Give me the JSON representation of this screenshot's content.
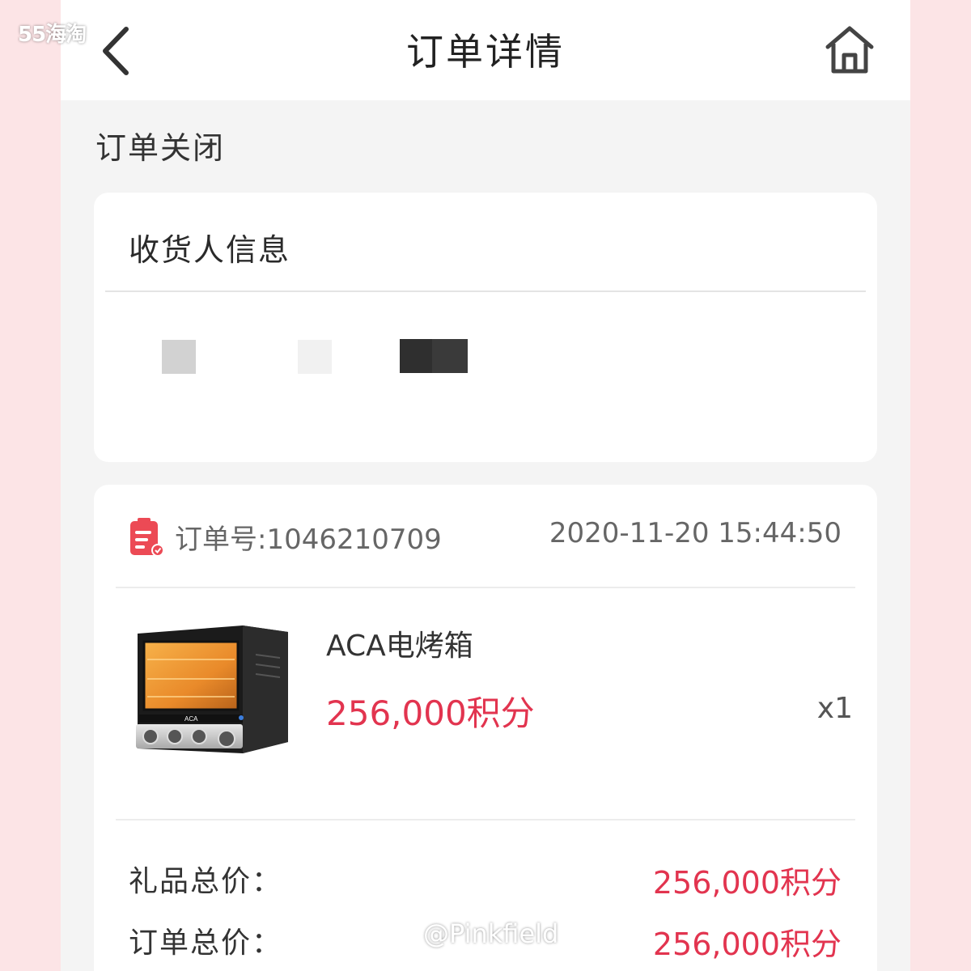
{
  "watermark": {
    "top_left": "55海淘",
    "bottom": "@Pinkfield"
  },
  "navbar": {
    "title": "订单详情",
    "back_icon": "chevron-left-icon",
    "home_icon": "home-icon"
  },
  "status": {
    "text": "订单关闭"
  },
  "recipient": {
    "title": "收货人信息"
  },
  "order": {
    "icon": "order-clipboard-icon",
    "number_label": "订单号:1046210709",
    "time": "2020-11-20 15:44:50",
    "product": {
      "name": "ACA电烤箱",
      "price": "256,000积分",
      "quantity": "x1",
      "image": "oven-product-image",
      "brand_on_image": "ACA"
    },
    "summary": [
      {
        "label": "礼品总价：",
        "value": "256,000积分"
      },
      {
        "label": "订单总价：",
        "value": "256,000积分"
      }
    ]
  },
  "colors": {
    "accent": "#e2344f",
    "background": "#f4f4f4",
    "side": "#fce4e6"
  }
}
